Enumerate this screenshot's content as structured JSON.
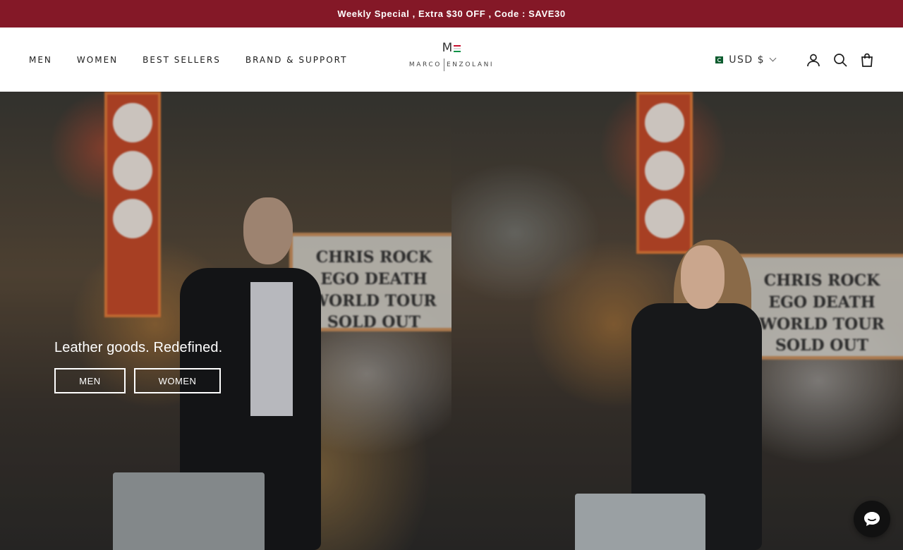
{
  "announcement": {
    "text": "Weekly Special , Extra $30 OFF , Code : SAVE30"
  },
  "nav": {
    "items": [
      {
        "label": "MEN"
      },
      {
        "label": "WOMEN"
      },
      {
        "label": "BEST SELLERS"
      },
      {
        "label": "BRAND & SUPPORT"
      }
    ]
  },
  "logo": {
    "mark_letter": "M",
    "left_text": "MARCO",
    "right_text": "ENZOLANI",
    "stripe_colors": [
      "#c8102e",
      "#ffffff",
      "#009246"
    ]
  },
  "header_right": {
    "currency_label": "USD $",
    "flag_icon": "pakistan-flag-icon",
    "icons": [
      "account-icon",
      "search-icon",
      "cart-icon"
    ]
  },
  "hero": {
    "left_marquee": "CHRIS ROCK\nEGO DEATH WORLD TOUR\nSOLD OUT",
    "right_marquee": "CHRIS ROCK\nEGO DEATH WORLD TOUR\nSOLD OUT",
    "heading": "Leather goods. Redefined.",
    "buttons": [
      {
        "label": "MEN"
      },
      {
        "label": "WOMEN"
      }
    ]
  },
  "chat": {
    "icon": "chat-icon"
  },
  "colors": {
    "announcement_bg": "#841827",
    "header_bg": "#ffffff",
    "chat_bg": "#111111"
  }
}
